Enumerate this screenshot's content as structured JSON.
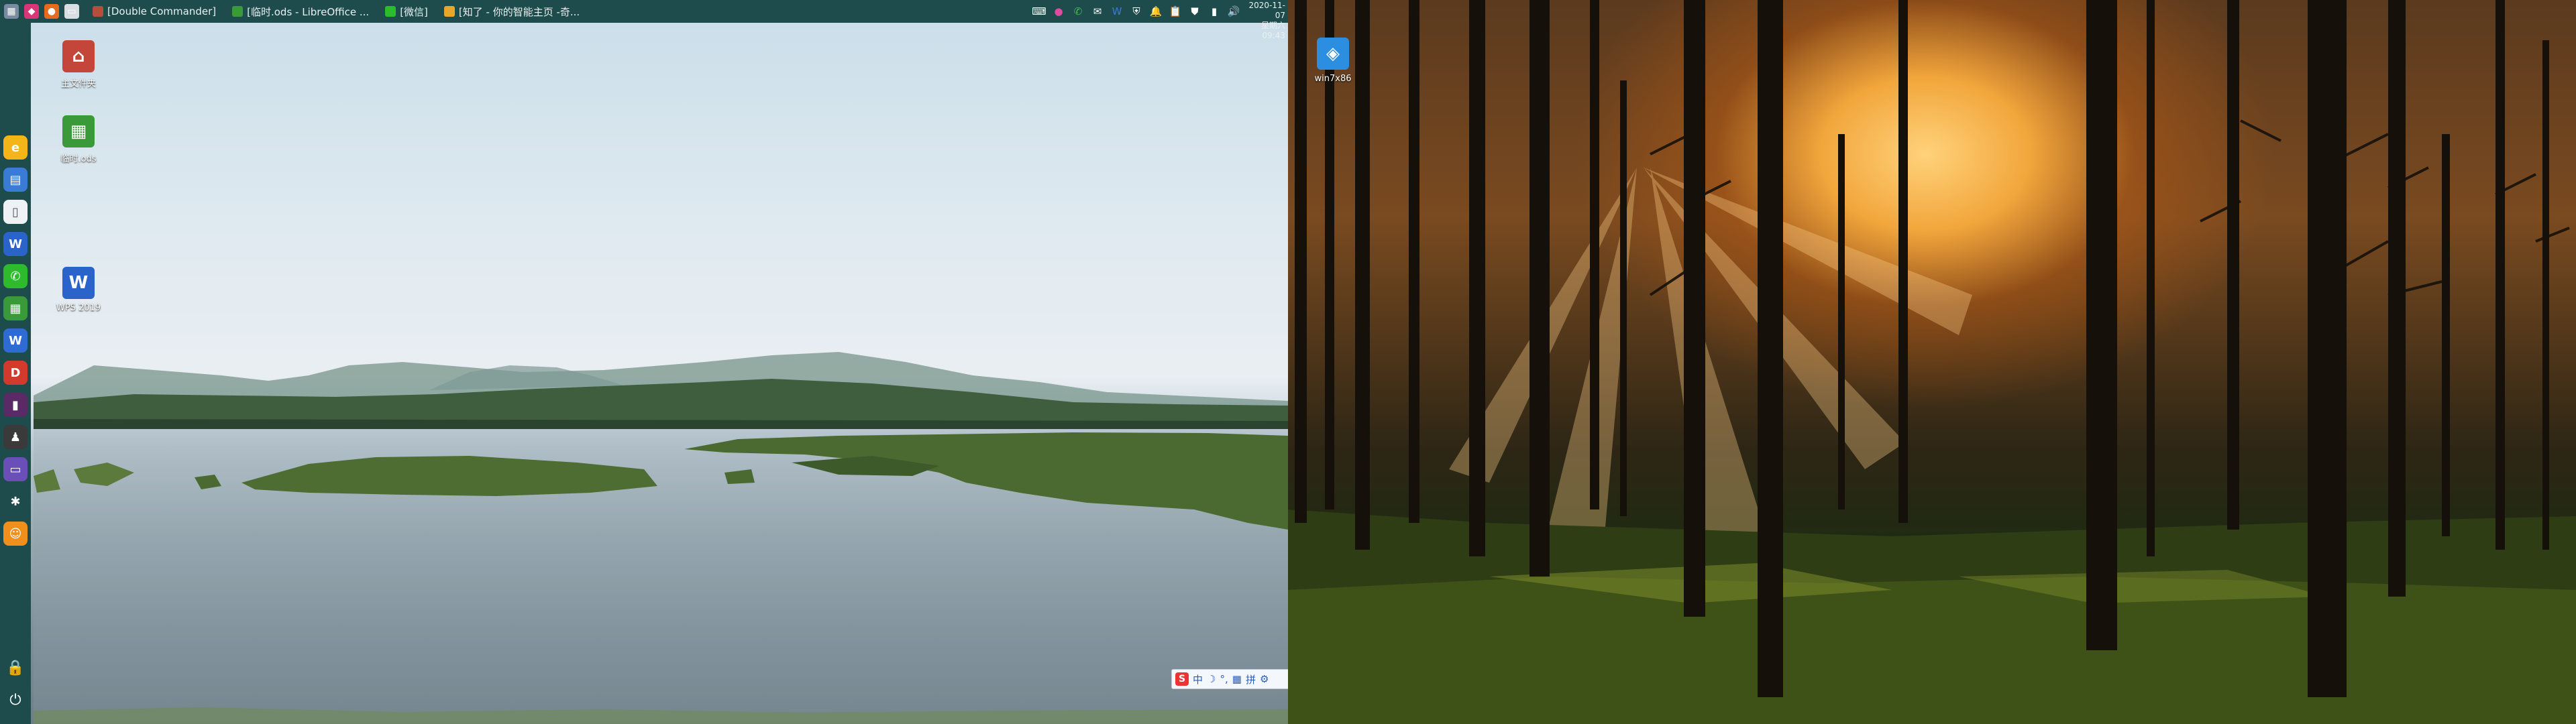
{
  "top_panel": {
    "quick_launch": [
      {
        "name": "apps-grid-icon",
        "color": "#7b8aa0",
        "glyph": "▦"
      },
      {
        "name": "color-app-icon",
        "color": "#d9367a",
        "glyph": "◆"
      },
      {
        "name": "firefox-icon",
        "color": "#e66b1f",
        "glyph": "●"
      },
      {
        "name": "files-icon",
        "color": "#d8dde3",
        "glyph": "▭"
      }
    ],
    "tasks": [
      {
        "label": "[Double Commander]",
        "color": "#b54e3c"
      },
      {
        "label": "[临时.ods - LibreOffice ...",
        "color": "#3a9a3a"
      },
      {
        "label": "[微信]",
        "color": "#2dbb2d"
      },
      {
        "label": "[知了 - 你的智能主页 -奇...",
        "color": "#e8a62b"
      }
    ],
    "tray_icons": [
      "keyboard-icon",
      "color-dots-icon",
      "wechat-icon",
      "chat-icon",
      "wps-icon",
      "shield-icon",
      "bell-icon",
      "clipboard-icon",
      "security-icon",
      "battery-icon",
      "volume-icon"
    ],
    "clock": {
      "date": "2020-11-07",
      "time": "星期六 09:43"
    }
  },
  "dock": {
    "items": [
      {
        "name": "dock-browser",
        "color": "#f3b517",
        "glyph": "e"
      },
      {
        "name": "dock-file-manager",
        "color": "#3a7bd5",
        "glyph": "▤"
      },
      {
        "name": "dock-document",
        "color": "#eef2f5",
        "glyph": "▯"
      },
      {
        "name": "dock-wps",
        "color": "#2a63c9",
        "glyph": "W"
      },
      {
        "name": "dock-wechat",
        "color": "#2dbb2d",
        "glyph": "✆"
      },
      {
        "name": "dock-calc",
        "color": "#3a9a3a",
        "glyph": "▦"
      },
      {
        "name": "dock-writer",
        "color": "#2e6bd2",
        "glyph": "W"
      },
      {
        "name": "dock-wps-pdf",
        "color": "#d23a2c",
        "glyph": "D"
      },
      {
        "name": "dock-dark-app",
        "color": "#5a2a66",
        "glyph": "▮"
      },
      {
        "name": "dock-penguin",
        "color": "#3a3a3a",
        "glyph": "♟"
      },
      {
        "name": "dock-storage",
        "color": "#6b4fb8",
        "glyph": "▭"
      },
      {
        "name": "dock-runner",
        "color": "#1e4b4b",
        "glyph": "✱"
      },
      {
        "name": "dock-user",
        "color": "#f08f1c",
        "glyph": "☺"
      }
    ]
  },
  "desktop_left": {
    "icons": [
      {
        "label": "主文件夹",
        "color": "#c4453a",
        "glyph": "⌂"
      },
      {
        "label": "临时.ods",
        "color": "#3a9a3a",
        "glyph": "▦"
      },
      {
        "label": "WPS 2019",
        "color": "#2a63c9",
        "glyph": "W"
      }
    ]
  },
  "desktop_right": {
    "icons": [
      {
        "label": "win7x86",
        "color": "#2b8ee0",
        "glyph": "◈"
      }
    ]
  },
  "ime": {
    "items": [
      "中",
      "☽",
      "°,",
      "▦",
      "拼",
      "⚙"
    ]
  }
}
